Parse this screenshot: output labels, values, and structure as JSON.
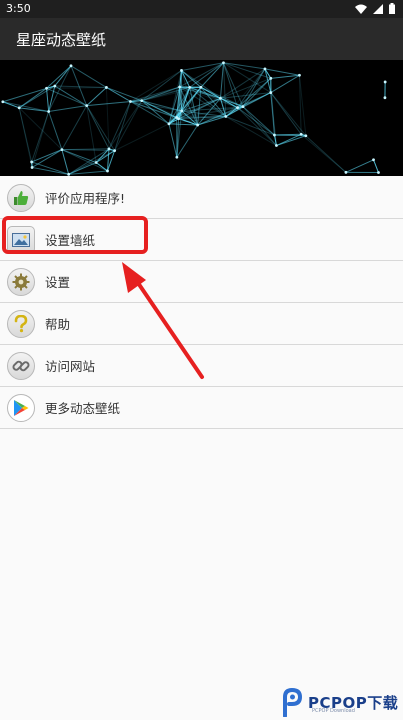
{
  "status_bar": {
    "time": "3:50",
    "icons": [
      "wifi-icon",
      "signal-icon",
      "battery-icon"
    ]
  },
  "app_bar": {
    "title": "星座动态壁纸"
  },
  "banner": {
    "image": "constellation-network-banner"
  },
  "menu": {
    "items": [
      {
        "label": "评价应用程序!",
        "icon": "thumbs-up-icon"
      },
      {
        "label": "设置墙纸",
        "icon": "wallpaper-icon"
      },
      {
        "label": "设置",
        "icon": "gear-icon"
      },
      {
        "label": "帮助",
        "icon": "question-icon"
      },
      {
        "label": "访问网站",
        "icon": "link-icon"
      },
      {
        "label": "更多动态壁纸",
        "icon": "play-store-icon"
      }
    ]
  },
  "annotation": {
    "color": "#e62020",
    "target": "设置墙纸"
  },
  "watermark": {
    "brand": "PCPOP下载",
    "sub": "PCPOP Download"
  }
}
